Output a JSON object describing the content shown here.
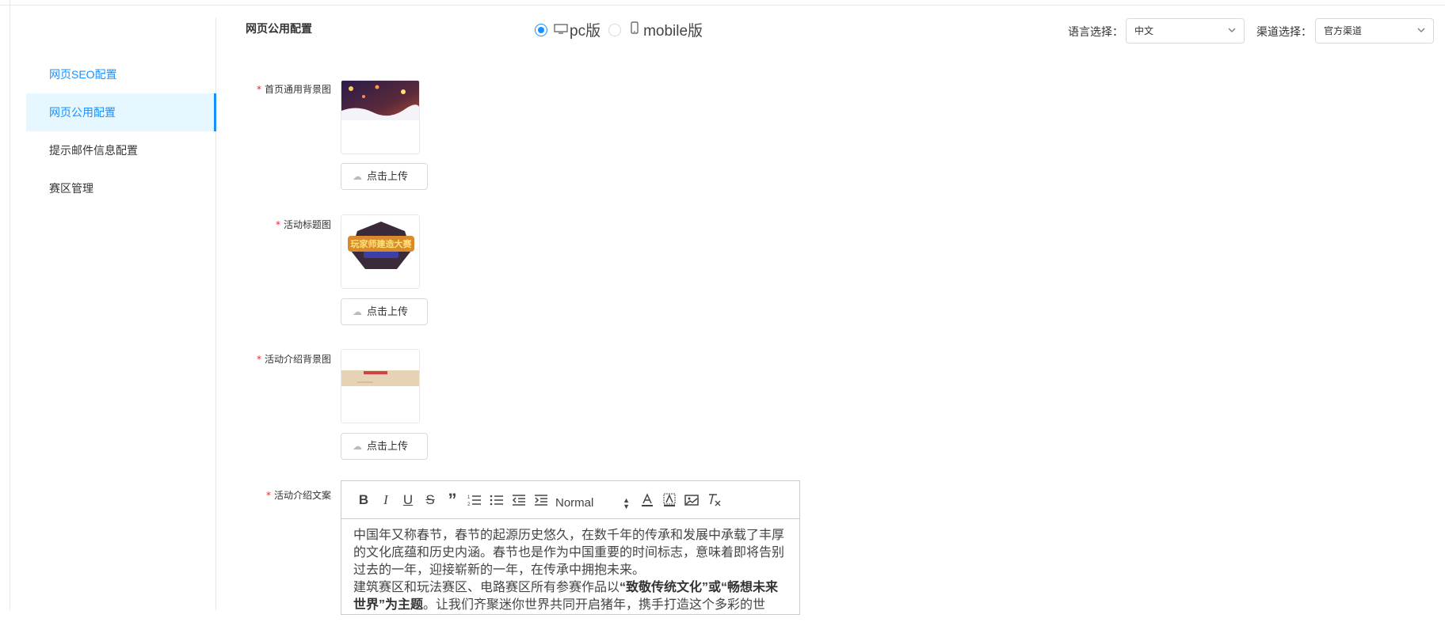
{
  "sidebar": {
    "items": [
      {
        "label": "网页SEO配置"
      },
      {
        "label": "网页公用配置"
      },
      {
        "label": "提示邮件信息配置"
      },
      {
        "label": "赛区管理"
      }
    ]
  },
  "header": {
    "title": "网页公用配置",
    "pc_label": "pc版",
    "mobile_label": "mobile版",
    "lang_label": "语言选择：",
    "lang_value": "中文",
    "channel_label": "渠道选择：",
    "channel_value": "官方渠道"
  },
  "form": {
    "bg_label": "首页通用背景图",
    "title_img_label": "活动标题图",
    "intro_bg_label": "活动介绍背景图",
    "intro_text_label": "活动介绍文案",
    "upload_label": "点击上传",
    "required_mark": "*",
    "title_img_text": "玩家师建造大赛"
  },
  "editor": {
    "format_value": "Normal",
    "para1": "中国年又称春节，春节的起源历史悠久，在数千年的传承和发展中承载了丰厚的文化底蕴和历史内涵。春节也是作为中国重要的时间标志，意味着即将告别过去的一年，迎接崭新的一年，在传承中拥抱未来。",
    "para2_start": " 建筑赛区和玩法赛区、电路赛区所有参赛作品以",
    "para2_bold": "“致敬传统文化”或“畅想未来世界”为主题",
    "para2_end": "。让我们齐聚迷你世界共同开启猪年，携手打造这个多彩的世"
  },
  "colors": {
    "accent": "#1890ff",
    "required": "#f5222d"
  }
}
